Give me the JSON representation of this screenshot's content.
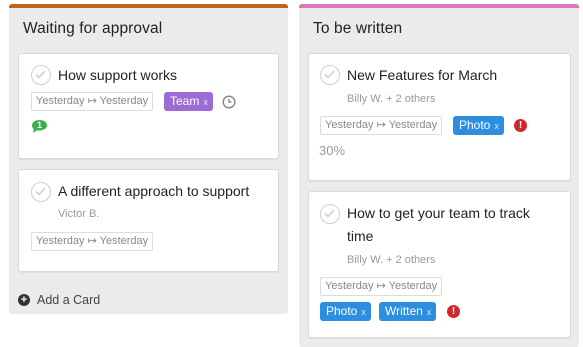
{
  "columns": [
    {
      "title": "Waiting for approval",
      "color": "#c0621b",
      "add_card_label": "Add a Card",
      "cards": [
        {
          "title": "How support works",
          "date_range": "Yesterday ↦ Yesterday",
          "tags": [
            {
              "label": "Team",
              "color": "#9b6bd6"
            }
          ],
          "icons": [
            "clock-icon",
            "comment-icon"
          ],
          "comment_count": "1"
        },
        {
          "title": "A different approach to support",
          "assignee": "Victor B.",
          "date_range": "Yesterday ↦ Yesterday"
        }
      ]
    },
    {
      "title": "To be written",
      "color": "#d77ab9",
      "cards": [
        {
          "title": "New Features for March",
          "assignee": "Billy W. + 2 others",
          "date_range": "Yesterday ↦ Yesterday",
          "tags": [
            {
              "label": "Photo",
              "color": "#2d8ee0"
            }
          ],
          "icons": [
            "alert-icon"
          ],
          "progress": "30%"
        },
        {
          "title_line1": "How to get your team to track",
          "title_line2": "time",
          "assignee": "Billy W. + 2 others",
          "date_range": "Yesterday ↦ Yesterday",
          "tags": [
            {
              "label": "Photo",
              "color": "#2d8ee0"
            },
            {
              "label": "Written",
              "color": "#2d8ee0"
            }
          ],
          "icons": [
            "alert-icon"
          ]
        }
      ]
    }
  ],
  "tag_remove_glyph": "x",
  "alert_glyph": "!"
}
